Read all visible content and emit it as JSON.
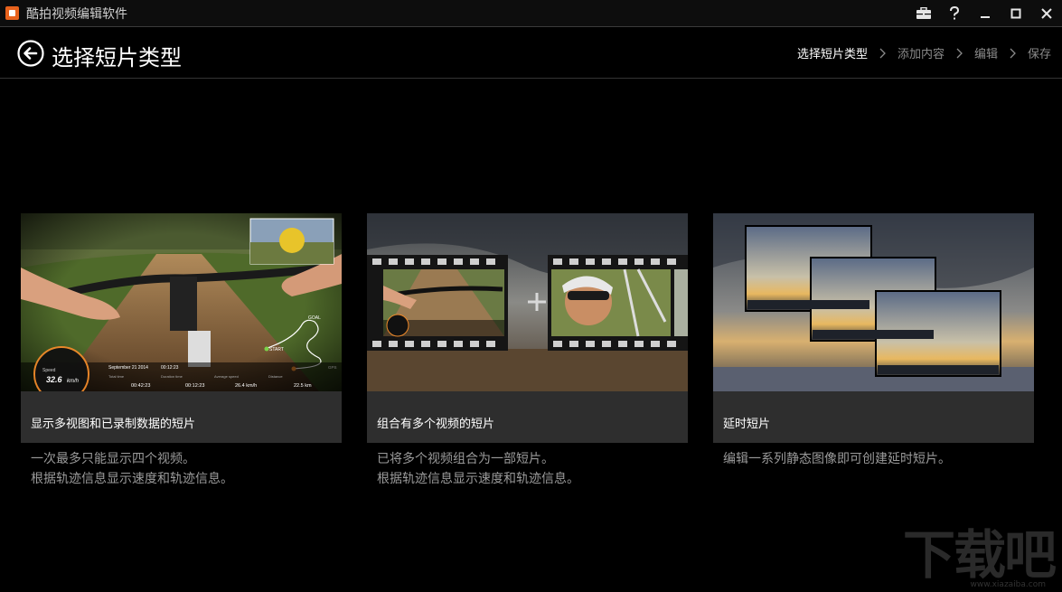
{
  "app": {
    "title": "酷拍视频编辑软件"
  },
  "header": {
    "title": "选择短片类型"
  },
  "breadcrumb": {
    "items": [
      "选择短片类型",
      "添加内容",
      "编辑",
      "保存"
    ]
  },
  "cards": [
    {
      "label": "显示多视图和已录制数据的短片",
      "desc": [
        "一次最多只能显示四个视频。",
        "根据轨迹信息显示速度和轨迹信息。"
      ],
      "overlay": {
        "speed_label": "Speed",
        "speed_value": "32.6",
        "speed_unit": "km/h",
        "date": "September 21 2014",
        "time": "00:12:23",
        "total_time_label": "Total time",
        "total_time": "00:42:23",
        "duration_label": "Duration time",
        "duration": "00:12:23",
        "avg_speed_label": "Average speed",
        "avg_speed": "26.4 km/h",
        "distance_label": "Distance",
        "distance": "22.5 km",
        "goal": "GOAL",
        "start": "START",
        "gps": "GPS"
      }
    },
    {
      "label": "组合有多个视频的短片",
      "desc": [
        "已将多个视频组合为一部短片。",
        "根据轨迹信息显示速度和轨迹信息。"
      ],
      "plus": "+"
    },
    {
      "label": "延时短片",
      "desc": [
        "编辑一系列静态图像即可创建延时短片。"
      ]
    }
  ],
  "watermark": {
    "text": "下载吧",
    "url": "www.xiazaiba.com"
  }
}
